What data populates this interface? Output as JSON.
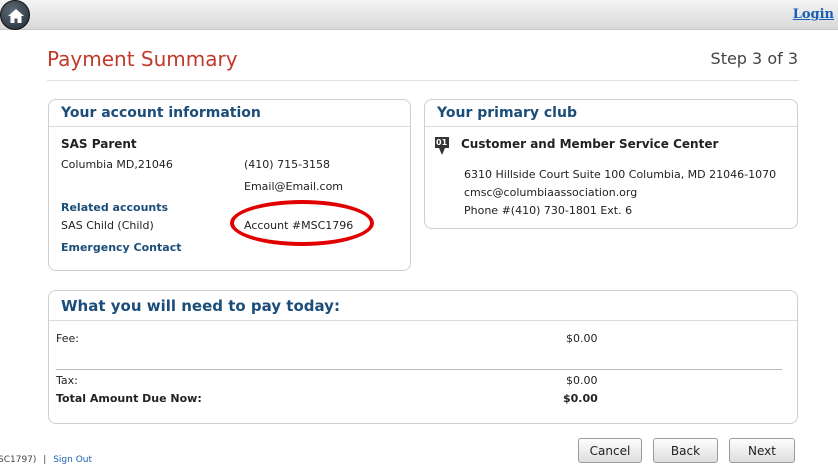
{
  "header": {
    "login_label": "Login",
    "home_icon": "home-icon"
  },
  "page": {
    "title": "Payment Summary",
    "step": "Step 3 of 3"
  },
  "account_info": {
    "heading": "Your account information",
    "name": "SAS Parent",
    "city": "Columbia MD,21046",
    "phone": "(410) 715-3158",
    "email": "Email@Email.com",
    "related_heading": "Related accounts",
    "related_child": "SAS Child (Child)",
    "account_number": "Account #MSC1796",
    "emergency_contact": "Emergency Contact"
  },
  "primary_club": {
    "heading": "Your primary club",
    "badge": "01",
    "name": "Customer and Member Service Center",
    "address": "6310 Hillside Court Suite 100 Columbia, MD 21046-1070",
    "email": "cmsc@columbiaassociation.org",
    "phone": "Phone #(410) 730-1801 Ext. 6"
  },
  "payment": {
    "heading": "What you will need to pay today:",
    "fee_label": "Fee:",
    "fee_value": "$0.00",
    "tax_label": "Tax:",
    "tax_value": "$0.00",
    "total_label": "Total Amount Due Now:",
    "total_value": "$0.00"
  },
  "actions": {
    "cancel": "Cancel",
    "back": "Back",
    "next": "Next"
  },
  "footer": {
    "account_fragment": "SC1797)",
    "separator": "|",
    "sign_out": "Sign Out"
  },
  "colors": {
    "title_red": "#c0392b",
    "heading_blue": "#1b4d7a",
    "highlight_ellipse": "#e00000",
    "link_blue": "#1a5fb4"
  }
}
